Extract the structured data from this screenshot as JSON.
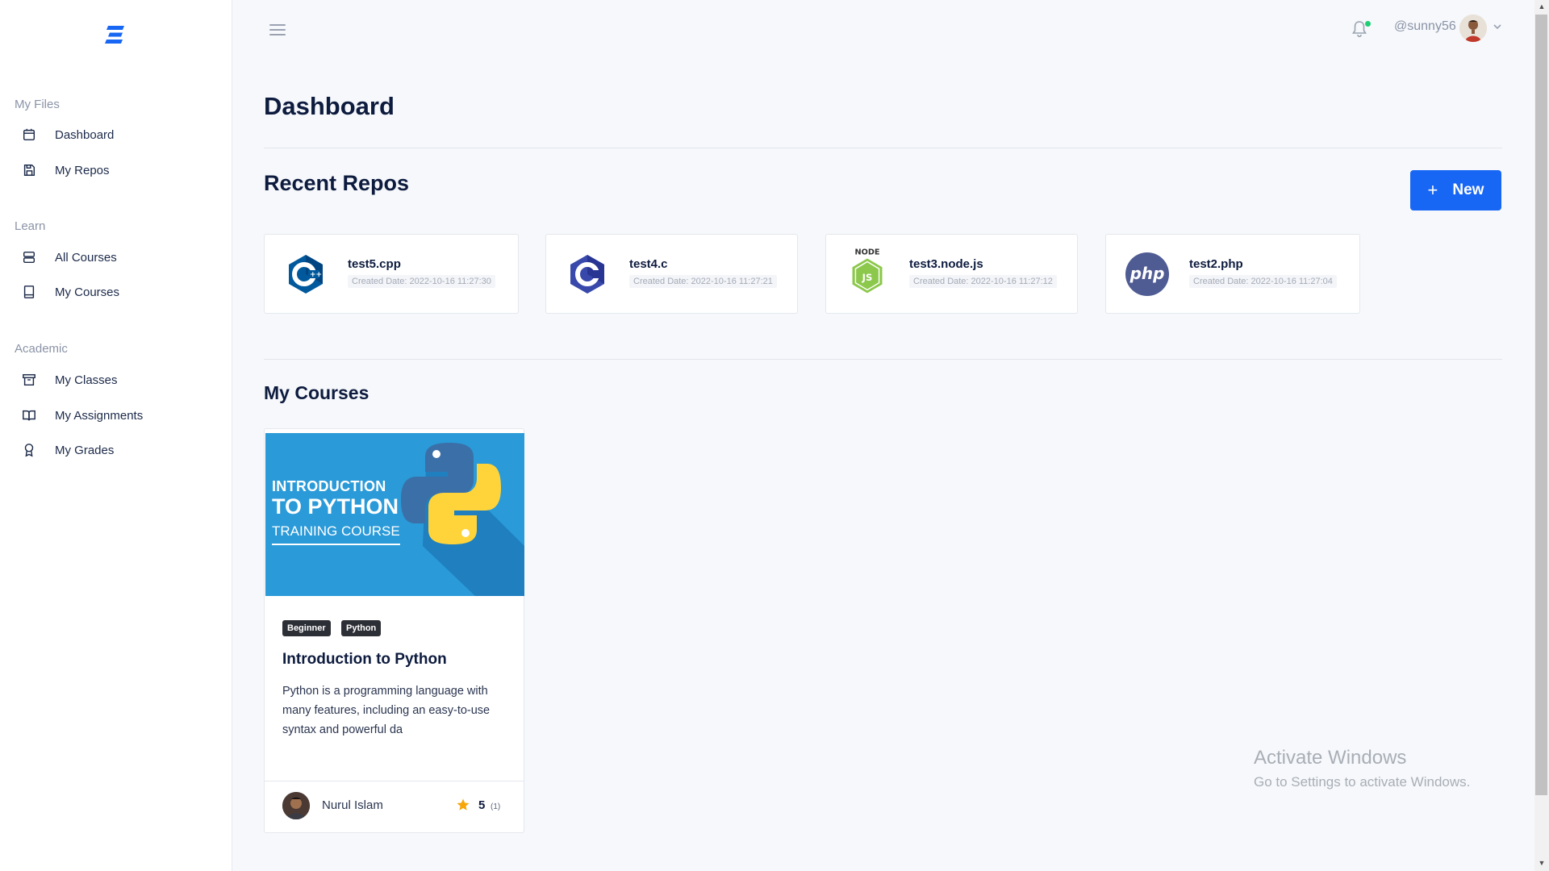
{
  "sidebar": {
    "logo": "brand-logo",
    "sections": [
      {
        "title": "My Files",
        "items": [
          {
            "label": "Dashboard",
            "icon": "calendar-icon"
          },
          {
            "label": "My Repos",
            "icon": "save-icon"
          }
        ]
      },
      {
        "title": "Learn",
        "items": [
          {
            "label": "All Courses",
            "icon": "server-icon"
          },
          {
            "label": "My Courses",
            "icon": "book-device-icon"
          }
        ]
      },
      {
        "title": "Academic",
        "items": [
          {
            "label": "My Classes",
            "icon": "archive-icon"
          },
          {
            "label": "My Assignments",
            "icon": "open-book-icon"
          },
          {
            "label": "My Grades",
            "icon": "award-icon"
          }
        ]
      }
    ]
  },
  "topbar": {
    "username": "@sunny56",
    "notification_dot_color": "#1fce74"
  },
  "main": {
    "page_title": "Dashboard",
    "recent_repos": {
      "title": "Recent Repos",
      "new_button_label": "New",
      "repos": [
        {
          "name": "test5.cpp",
          "date": "Created Date: 2022-10-16 11:27:30",
          "icon": "cpp-logo-icon"
        },
        {
          "name": "test4.c",
          "date": "Created Date: 2022-10-16 11:27:21",
          "icon": "c-logo-icon"
        },
        {
          "name": "test3.node.js",
          "date": "Created Date: 2022-10-16 11:27:12",
          "icon": "nodejs-logo-icon"
        },
        {
          "name": "test2.php",
          "date": "Created Date: 2022-10-16 11:27:04",
          "icon": "php-logo-icon"
        }
      ]
    },
    "my_courses": {
      "title": "My Courses",
      "courses": [
        {
          "banner_line1": "INTRODUCTION",
          "banner_line2": "TO PYTHON",
          "banner_line3": "TRAINING COURSE",
          "tags": [
            "Beginner",
            "Python"
          ],
          "title": "Introduction to Python",
          "description": "Python is a programming language with many features, including an easy-to-use syntax and powerful da",
          "author": "Nurul Islam",
          "rating": "5",
          "rating_count": "(1)"
        }
      ]
    }
  },
  "watermark": {
    "line1": "Activate Windows",
    "line2": "Go to Settings to activate Windows."
  },
  "colors": {
    "accent": "#1766f4",
    "background": "#f6f8fb",
    "heading": "#0d1b3e"
  }
}
